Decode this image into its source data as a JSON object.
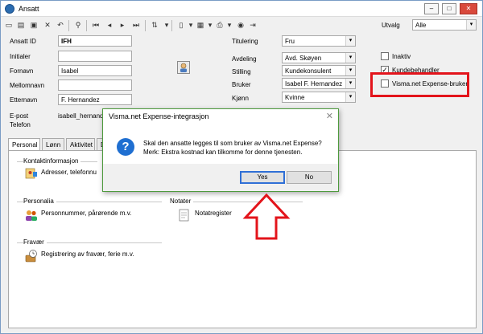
{
  "window": {
    "title": "Ansatt",
    "min_label": "–",
    "max_label": "□",
    "close_label": "✕"
  },
  "toolbar": {
    "icons": [
      "new-icon",
      "open-icon",
      "save-icon",
      "delete-icon",
      "undo-icon",
      "search-icon",
      "first-icon",
      "prev-icon",
      "next-icon",
      "last-icon",
      "sort-icon",
      "document-icon",
      "report-icon",
      "print-icon",
      "help-icon",
      "exit-icon"
    ]
  },
  "utvalg": {
    "label": "Utvalg",
    "value": "Alle"
  },
  "form": {
    "ansatt_id": {
      "label": "Ansatt ID",
      "value": "IFH"
    },
    "initialer": {
      "label": "Initialer",
      "value": ""
    },
    "fornavn": {
      "label": "Fornavn",
      "value": "Isabel"
    },
    "mellomnavn": {
      "label": "Mellomnavn",
      "value": ""
    },
    "etternavn": {
      "label": "Etternavn",
      "value": "F. Hernandez"
    },
    "epost": {
      "label": "E-post",
      "value": "isabell_hernandez"
    },
    "telefon": {
      "label": "Telefon",
      "value": ""
    },
    "titulering": {
      "label": "Titulering",
      "value": "Fru"
    },
    "avdeling": {
      "label": "Avdeling",
      "value": "Avd. Skøyen"
    },
    "stilling": {
      "label": "Stilling",
      "value": "Kundekonsulent"
    },
    "bruker": {
      "label": "Bruker",
      "value": "Isabel F. Hernandez"
    },
    "kjonn": {
      "label": "Kjønn",
      "value": "Kvinne"
    }
  },
  "checkboxes": {
    "inaktiv": {
      "label": "Inaktiv",
      "checked": false
    },
    "kundebehandler": {
      "label": "Kundebehandler",
      "checked": true,
      "mark": "✓"
    },
    "visma_expense": {
      "label": "Visma.net Expense-bruker",
      "checked": false
    }
  },
  "tabs": [
    "Personal",
    "Lønn",
    "Aktivitet",
    "D"
  ],
  "panel": {
    "kontakt": {
      "title": "Kontaktinformasjon",
      "text": "Adresser, telefonnu"
    },
    "personalia": {
      "title": "Personalia",
      "text": "Personnummer, pårørende m.v."
    },
    "notater": {
      "title": "Notater",
      "text": "Notatregister"
    },
    "fravaer": {
      "title": "Fravær",
      "text": "Registrering av fravær, ferie m.v."
    }
  },
  "dialog": {
    "title": "Visma.net Expense-integrasjon",
    "close": "✕",
    "icon_glyph": "?",
    "line1": "Skal den ansatte legges til som bruker av Visma.net Expense?",
    "line2": "Merk: Ekstra kostnad kan tilkomme for denne tjenesten.",
    "yes": "Yes",
    "no": "No"
  },
  "colors": {
    "highlight": "#e3141b",
    "dialog_border": "#4e9a3d",
    "accent": "#1f6fd1"
  }
}
